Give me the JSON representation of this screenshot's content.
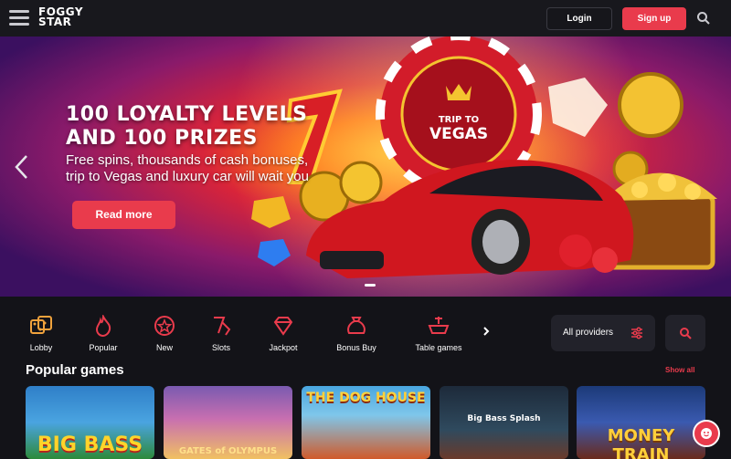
{
  "header": {
    "logo_line1": "FOGGY",
    "logo_line2": "STAR",
    "login_label": "Login",
    "signup_label": "Sign up"
  },
  "banner": {
    "title_line1": "100 LOYALTY LEVELS",
    "title_line2": "AND 100 PRIZES",
    "subtitle_line1": "Free spins, thousands of cash bonuses,",
    "subtitle_line2": "trip to Vegas and luxury car will wait you",
    "chip_line1": "TRIP TO",
    "chip_line2": "VEGAS",
    "read_more_label": "Read more"
  },
  "categories": [
    {
      "label": "Lobby",
      "icon": "dice-icon"
    },
    {
      "label": "Popular",
      "icon": "fire-icon"
    },
    {
      "label": "New",
      "icon": "star-icon"
    },
    {
      "label": "Slots",
      "icon": "slots-icon"
    },
    {
      "label": "Jackpot",
      "icon": "jackpot-icon"
    },
    {
      "label": "Bonus Buy",
      "icon": "bonus-bag-icon"
    },
    {
      "label": "Table games",
      "icon": "table-games-icon"
    }
  ],
  "filters": {
    "providers_label": "All providers"
  },
  "popular": {
    "title": "Popular games",
    "show_all_label": "Show all",
    "games": [
      {
        "title": "BIG BASS"
      },
      {
        "title": "GATES of OLYMPUS"
      },
      {
        "title": "THE DOG HOUSE"
      },
      {
        "title": "Big Bass Splash"
      },
      {
        "title": "MONEY TRAIN"
      }
    ]
  },
  "colors": {
    "accent": "#e93b4c",
    "background": "#131318",
    "panel": "#22222a"
  }
}
